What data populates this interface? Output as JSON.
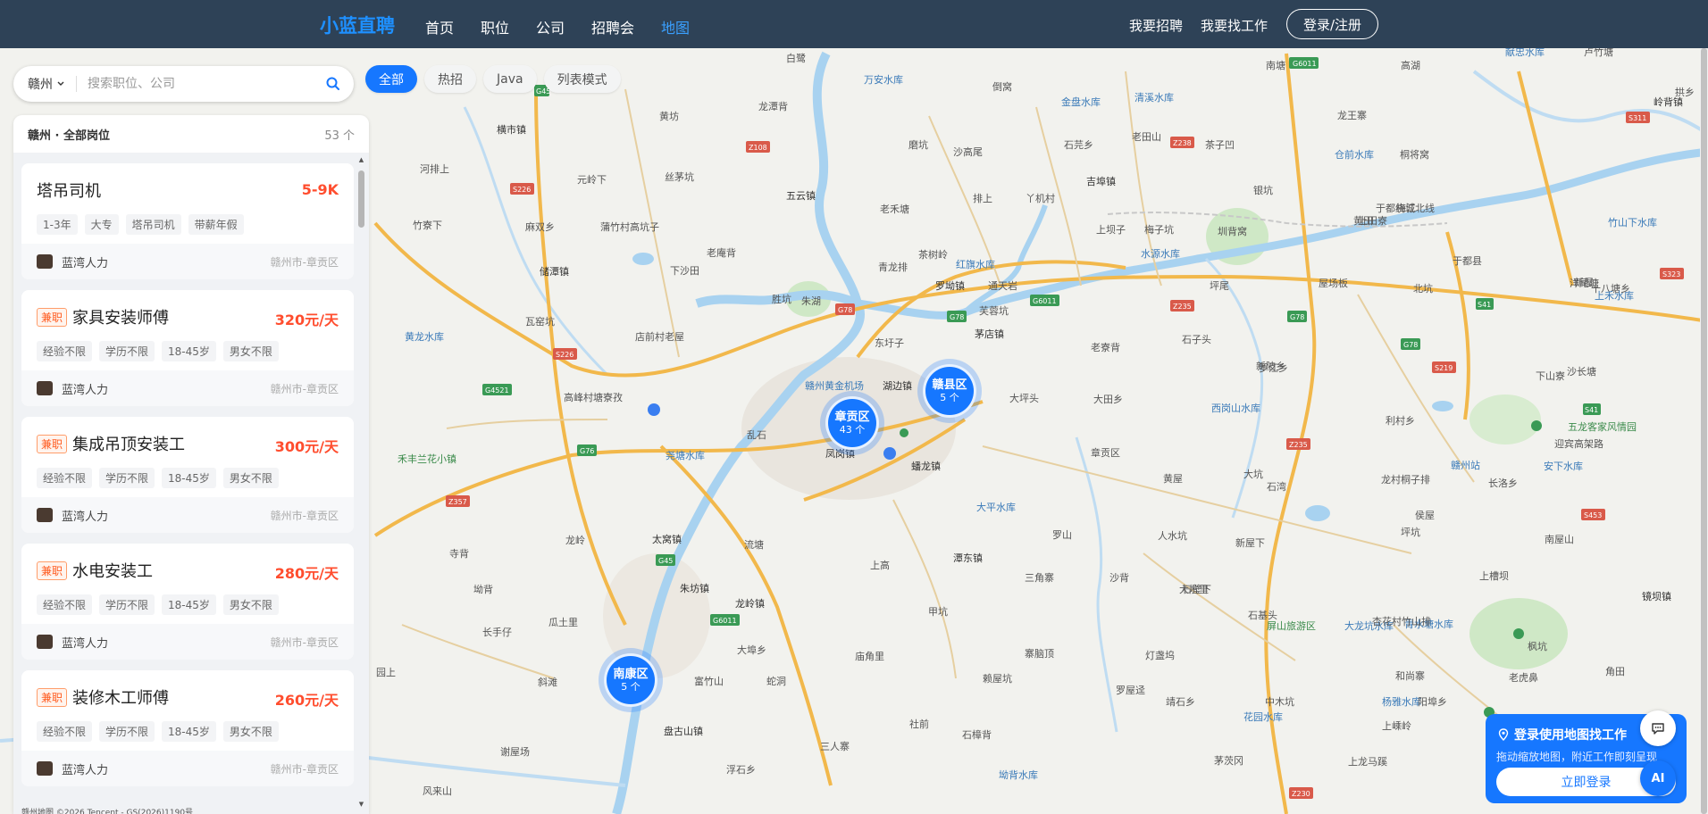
{
  "nav": {
    "brand": "小蓝直聘",
    "items": [
      {
        "label": "首页",
        "active": false
      },
      {
        "label": "职位",
        "active": false
      },
      {
        "label": "公司",
        "active": false
      },
      {
        "label": "招聘会",
        "active": false
      },
      {
        "label": "地图",
        "active": true
      }
    ],
    "recruit": "我要招聘",
    "find_job": "我要找工作",
    "login": "登录/注册"
  },
  "search": {
    "city": "赣州",
    "placeholder": "搜索职位、公司"
  },
  "chips": [
    {
      "label": "全部",
      "active": true
    },
    {
      "label": "热招",
      "active": false
    },
    {
      "label": "Java",
      "active": false
    },
    {
      "label": "列表模式",
      "active": false
    }
  ],
  "panel": {
    "title": "赣州 · 全部岗位",
    "count": "53 个"
  },
  "jobs": [
    {
      "part": "",
      "title": "塔吊司机",
      "salary": "5-9K",
      "tags": [
        "1-3年",
        "大专",
        "塔吊司机",
        "带薪年假"
      ],
      "company": "蓝湾人力",
      "location": "赣州市-章贡区"
    },
    {
      "part": "兼职",
      "title": "家具安装师傅",
      "salary": "320元/天",
      "tags": [
        "经验不限",
        "学历不限",
        "18-45岁",
        "男女不限"
      ],
      "company": "蓝湾人力",
      "location": "赣州市-章贡区"
    },
    {
      "part": "兼职",
      "title": "集成吊顶安装工",
      "salary": "300元/天",
      "tags": [
        "经验不限",
        "学历不限",
        "18-45岁",
        "男女不限"
      ],
      "company": "蓝湾人力",
      "location": "赣州市-章贡区"
    },
    {
      "part": "兼职",
      "title": "水电安装工",
      "salary": "280元/天",
      "tags": [
        "经验不限",
        "学历不限",
        "18-45岁",
        "男女不限"
      ],
      "company": "蓝湾人力",
      "location": "赣州市-章贡区"
    },
    {
      "part": "兼职",
      "title": "装修木工师傅",
      "salary": "260元/天",
      "tags": [
        "经验不限",
        "学历不限",
        "18-45岁",
        "男女不限"
      ],
      "company": "蓝湾人力",
      "location": "赣州市-章贡区"
    }
  ],
  "clusters": [
    {
      "name": "章贡区",
      "count": "43 个"
    },
    {
      "name": "赣县区",
      "count": "5 个"
    },
    {
      "name": "南康区",
      "count": "5 个"
    }
  ],
  "places": [
    "白鹭",
    "万安水库",
    "倒窝",
    "金盘水库",
    "清溪水库",
    "南塘",
    "高湖",
    "献忠水库",
    "卢竹塘",
    "黄坊",
    "龙潭背",
    "磨坑",
    "沙高尾",
    "石芫乡",
    "老田山",
    "茶子凹",
    "龙王寨",
    "拱乡",
    "横市镇",
    "元岭下",
    "丝茅坑",
    "吉埠镇",
    "仓前水库",
    "桐将窝",
    "岭背镇",
    "河排上",
    "五云镇",
    "老禾塘",
    "排上",
    "丫机村",
    "银坑",
    "于都绕城北线",
    "梅江",
    "竹山下水库",
    "黄田",
    "竹寮下",
    "麻双乡",
    "蒲竹村高坑子",
    "上坝子",
    "梅子坑",
    "圳背窝",
    "上田寮",
    "于都县",
    "老庵背",
    "茶树岭",
    "储潭镇",
    "下沙田",
    "水源水库",
    "坪尾",
    "屋场板",
    "青龙排",
    "罗坳镇",
    "洋尾塘",
    "胜坑",
    "朱湖",
    "红旗水库",
    "通天岩",
    "茅店镇",
    "北坑",
    "新屋",
    "十八塘乡",
    "瓦窑坑",
    "黄龙水库",
    "芙蓉坑",
    "东圩子",
    "老寮背",
    "石子头",
    "上禾水库",
    "罗江乡",
    "沙长塘",
    "店前村老屋",
    "湖边镇",
    "新陂乡",
    "下山寮",
    "高峰村塘寮孜",
    "赣州黄金机场",
    "大坪头",
    "大田乡",
    "西岗山水库",
    "利村乡",
    "迎宾高架路",
    "五龙客家风情园",
    "禾丰兰花小镇",
    "尧塘水库",
    "乱石",
    "凤岗镇",
    "蟠龙镇",
    "章贡区",
    "赣州站",
    "大坑",
    "安下水库",
    "黄屋",
    "石湾",
    "龙村桐子排",
    "长洛乡",
    "大平水库",
    "侯屋",
    "寺背",
    "龙岭",
    "太窝镇",
    "流塘",
    "潭东镇",
    "罗山",
    "人水坑",
    "新屋下",
    "坪坑",
    "南屋山",
    "上高",
    "三角寨",
    "沙背",
    "石壁下",
    "上槽坝",
    "坳背",
    "朱坊镇",
    "龙岭镇",
    "甲坑",
    "大坑里",
    "石基头",
    "大龙坑水库",
    "青水塘水库",
    "镜坝镇",
    "长手仔",
    "瓜土里",
    "大埠乡",
    "庙角里",
    "寨脑顶",
    "灯盏坞",
    "屏山旅游区",
    "杏花村竹山排",
    "枫坑",
    "园上",
    "斜滩",
    "富竹山",
    "蛇洞",
    "赖屋坑",
    "靖石乡",
    "中木坑",
    "和尚寨",
    "老虎鼻",
    "杨雅水库",
    "角田",
    "盘古山镇",
    "社前",
    "罗屋迳",
    "花园水库",
    "阳埠乡",
    "上嵊岭",
    "谢屋场",
    "三人寨",
    "茅茨冈",
    "石樟背",
    "上龙马蹊",
    "风来山",
    "浮石乡",
    "坳背水库"
  ],
  "promo": {
    "title": "登录使用地图找工作",
    "subtitle": "拖动缩放地图，附近工作即刻呈现",
    "button": "立即登录",
    "ai": "AI"
  },
  "copyright": "赣州地图  ©2026 Tencent - GS(2026)1190号",
  "colors": {
    "accent": "#1677ff",
    "topbar": "#2e4257",
    "salary": "#ff4d2e",
    "brand": "#1e90ff"
  }
}
